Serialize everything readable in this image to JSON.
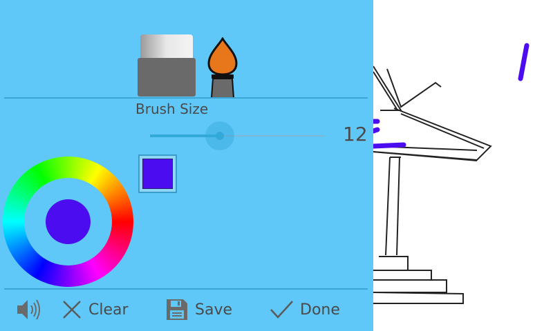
{
  "tools": {
    "eraser_icon": "eraser-icon",
    "brush_icon": "paintbrush-icon"
  },
  "brush": {
    "label": "Brush Size",
    "value": "12",
    "slider_fraction": 0.4
  },
  "color": {
    "selected_hex": "#4b0df0",
    "accent_hex": "#5fc8f8"
  },
  "toolbar": {
    "sound_icon": "speaker-icon",
    "clear_label": "Clear",
    "save_label": "Save",
    "done_label": "Done"
  }
}
